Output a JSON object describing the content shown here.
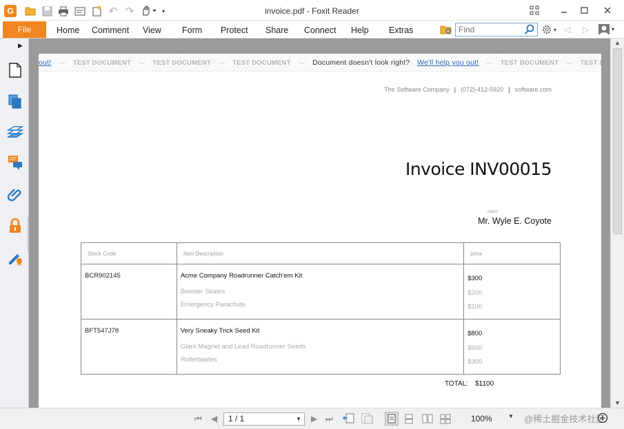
{
  "window": {
    "title": "invoice.pdf - Foxit Reader",
    "app_icon_letter": "G"
  },
  "menu": {
    "file": "File",
    "items": [
      "Home",
      "Comment",
      "View",
      "Form",
      "Protect",
      "Share",
      "Connect",
      "Help",
      "Extras"
    ],
    "find_placeholder": "Find"
  },
  "banner": {
    "link_partial": "out!",
    "test_document": "TEST DOCUMENT",
    "message": "Document doesn't look right?",
    "link": "We'll help you out!"
  },
  "invoice": {
    "company": "The Software Company",
    "phone": "(072)-412-5920",
    "website": "software.com",
    "title": "Invoice INV00015",
    "client_label": "client:",
    "client_name": "Mr. Wyle E. Coyote",
    "headers": {
      "stock_code": "Stock Code",
      "description": "Item Description",
      "price": "price"
    },
    "rows": [
      {
        "stock_code": "BCR902145",
        "item": "Acme Company Roadrunner Catch'em Kit",
        "price": "$300",
        "subitems": [
          {
            "name": "Booster Skates",
            "price": "$200"
          },
          {
            "name": "Emergency Parachute",
            "price": "$100"
          }
        ]
      },
      {
        "stock_code": "BFT547J78",
        "item": "Very Sneaky Trick Seed Kit",
        "price": "$800",
        "subitems": [
          {
            "name": "Giant Magnet and Lead Roadrunner Seeds",
            "price": "$500"
          },
          {
            "name": "Rollerblades",
            "price": "$300"
          }
        ]
      }
    ],
    "total_label": "TOTAL:",
    "total_value": "$1100"
  },
  "status": {
    "page": "1 / 1",
    "zoom": "100%",
    "watermark": "@稀土掘金技术社区"
  },
  "colors": {
    "accent": "#f0861f",
    "link": "#2a6ab8",
    "toolbar_icon": "#2d78c4"
  }
}
